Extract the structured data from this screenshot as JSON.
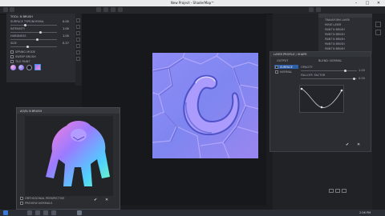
{
  "window": {
    "title": "New Project - ShaderMap™",
    "minimize": "–",
    "maximize": "□",
    "close": "✕"
  },
  "left_panel": {
    "title": "TOOL: N BRUSH",
    "params": [
      {
        "label": "SURFACE TYPE/NORMAL",
        "value": "0.00",
        "level": 0.3
      },
      {
        "label": "INTENSITY",
        "value": "1.00",
        "level": 0.62
      },
      {
        "label": "HARDNESS",
        "value": "1.00",
        "level": 0.55
      },
      {
        "label": "SIZE",
        "value": "0.27",
        "level": 0.35
      }
    ],
    "options": [
      "SPRING MODE",
      "SWEEP BRUSH",
      "TILE PAINT"
    ]
  },
  "layers_panel": {
    "items": [
      "TRANSFORM LAYER",
      "MOVE LAYER",
      "PAINT N BRUSH",
      "PAINT N BRUSH",
      "PAINT N BRUSH",
      "PAINT N BRUSH",
      "PAINT N BRUSH"
    ]
  },
  "layer_profile": {
    "title": "LAYER PROFILE / SHAPE",
    "output_label": "OUTPUT",
    "blend_mode": "BLEND: NORMAL",
    "outputs": [
      "SURFACE",
      "NORMAL"
    ],
    "params": [
      {
        "label": "OPACITY",
        "value": "1.00",
        "level": 0.8
      },
      {
        "label": "FALLOFF: FACTOR",
        "value": "0.00",
        "level": 0.95
      }
    ],
    "ok_glyph": "✔",
    "cancel_glyph": "✕"
  },
  "ao_panel": {
    "title": "AO/N: N BRUSH",
    "options": [
      "ORTHOGONAL PERSPECTIVE",
      "PREVIEW NORMALS"
    ],
    "ok_glyph": "✔",
    "cancel_glyph": "✕"
  },
  "taskbar": {
    "clock": "2:56 PM"
  },
  "colors": {
    "normal_base": "#8a86f2",
    "accent": "#4a90e2"
  }
}
